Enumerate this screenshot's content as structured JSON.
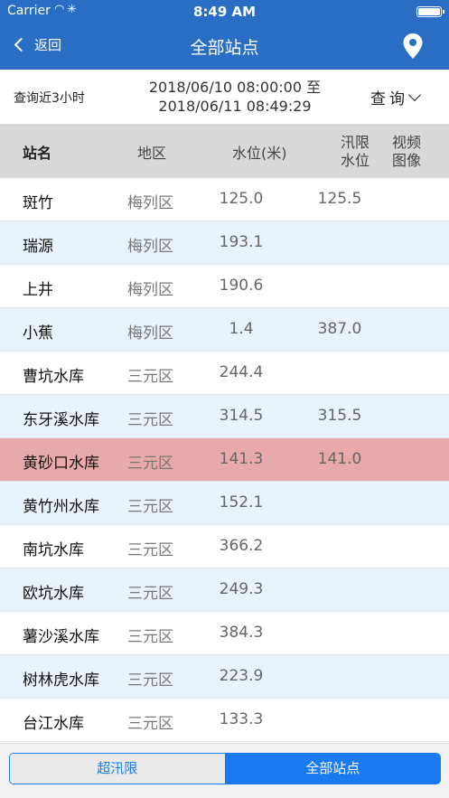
{
  "status_bar": {
    "carrier": "Carrier",
    "time": "8:49 AM"
  },
  "nav": {
    "back_label": "返回",
    "title": "全部站点",
    "location_icon": "map-pin-icon"
  },
  "query": {
    "label": "查询近3小时",
    "range_line1": "2018/06/10 08:00:00 至",
    "range_line2": "2018/06/11 08:49:29",
    "button_label": "查询"
  },
  "table": {
    "headers": {
      "name": "站名",
      "area": "地区",
      "level": "水位(米)",
      "flood_1": "汛限",
      "flood_2": "水位",
      "video_1": "视频",
      "video_2": "图像"
    },
    "rows": [
      {
        "name": "斑竹",
        "area": "梅列区",
        "level": "125.0",
        "flood": "125.5"
      },
      {
        "name": "瑞源",
        "area": "梅列区",
        "level": "193.1",
        "flood": ""
      },
      {
        "name": "上井",
        "area": "梅列区",
        "level": "190.6",
        "flood": ""
      },
      {
        "name": "小蕉",
        "area": "梅列区",
        "level": "1.4",
        "flood": "387.0"
      },
      {
        "name": "曹坑水库",
        "area": "三元区",
        "level": "244.4",
        "flood": ""
      },
      {
        "name": "东牙溪水库",
        "area": "三元区",
        "level": "314.5",
        "flood": "315.5"
      },
      {
        "name": "黄砂口水库",
        "area": "三元区",
        "level": "141.3",
        "flood": "141.0"
      },
      {
        "name": "黄竹州水库",
        "area": "三元区",
        "level": "152.1",
        "flood": ""
      },
      {
        "name": "南坑水库",
        "area": "三元区",
        "level": "366.2",
        "flood": ""
      },
      {
        "name": "欧坑水库",
        "area": "三元区",
        "level": "249.3",
        "flood": ""
      },
      {
        "name": "薯沙溪水库",
        "area": "三元区",
        "level": "384.3",
        "flood": ""
      },
      {
        "name": "树林虎水库",
        "area": "三元区",
        "level": "223.9",
        "flood": ""
      },
      {
        "name": "台江水库",
        "area": "三元区",
        "level": "133.3",
        "flood": ""
      }
    ]
  },
  "segmented": {
    "left_label": "超汛限",
    "right_label": "全部站点",
    "selected": "全部站点"
  },
  "colors": {
    "nav_bg": "#2a6dc4",
    "alt_row": "#e8f3fb",
    "highlight_row": "#e8a9ab",
    "accent": "#1a7bf0"
  }
}
